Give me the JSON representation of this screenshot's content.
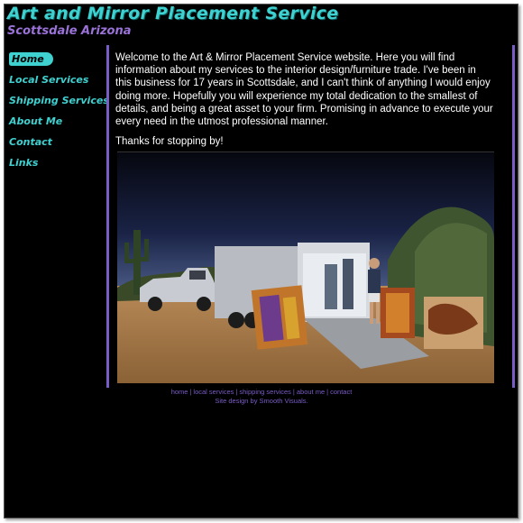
{
  "header": {
    "title": "Art and Mirror Placement Service",
    "subtitle": "Scottsdale Arizona"
  },
  "nav": {
    "items": [
      {
        "label": "Home",
        "active": true
      },
      {
        "label": "Local Services"
      },
      {
        "label": "Shipping Services"
      },
      {
        "label": "About Me"
      },
      {
        "label": "Contact"
      },
      {
        "label": "Links"
      }
    ]
  },
  "main": {
    "welcome": "Welcome to the Art & Mirror Placement Service website. Here you will find information about my services to the interior design/furniture trade. I've been in this business for 17 years in Scottsdale, and I can't think of anything I would enjoy doing more. Hopefully you will experience my total dedication to the smallest of details, and being a great asset to your firm. Promising in advance to execute your every need in the utmost professional manner.",
    "thanks": "Thanks for stopping by!"
  },
  "footer": {
    "links": [
      "home",
      "local services",
      "shipping services",
      "about me",
      "contact"
    ],
    "separator": "|",
    "credit": "Site design by Smooth Visuals."
  },
  "colors": {
    "background": "#000000",
    "title": "#3fd0d0",
    "subtitle": "#9a72d8",
    "accent_border": "#7a5cc6",
    "footer_text": "#7a5cc6"
  }
}
